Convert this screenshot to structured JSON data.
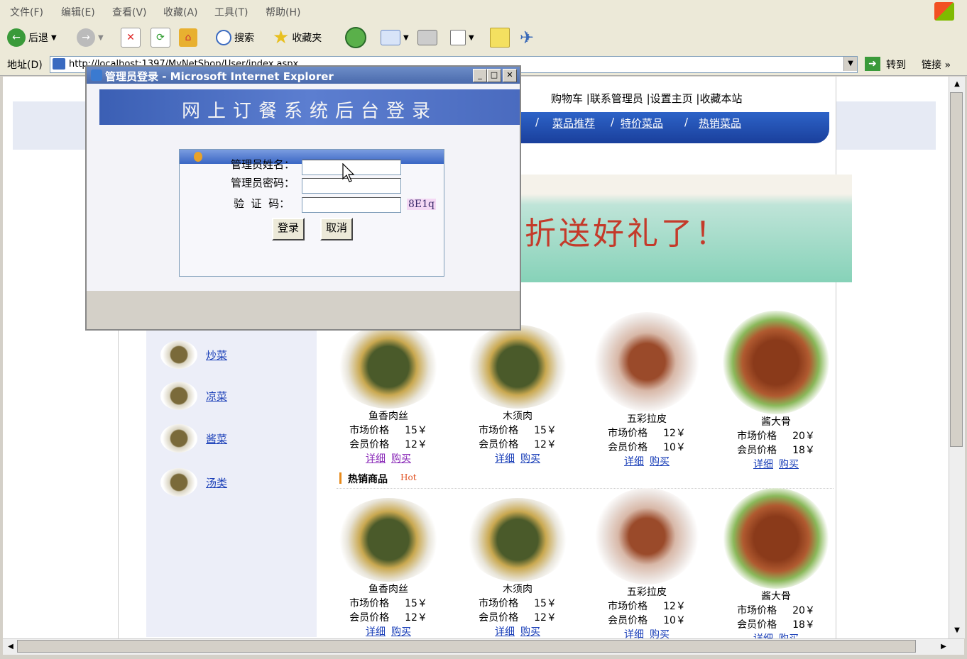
{
  "menu": [
    "文件(F)",
    "编辑(E)",
    "查看(V)",
    "收藏(A)",
    "工具(T)",
    "帮助(H)"
  ],
  "toolbar": {
    "back": "后退",
    "search": "搜索",
    "favorites": "收藏夹"
  },
  "address": {
    "label": "地址(D)",
    "url": "http://localhost:1397/MyNetShop/User/index.aspx",
    "go": "转到",
    "links": "链接 »"
  },
  "page": {
    "top_links": "购物车 |联系管理员 |设置主页 |收藏本站",
    "nav_links": [
      "菜品推荐",
      "特价菜品",
      "热销菜品"
    ],
    "nav_sep": "/",
    "banner_text": "折送好礼了！",
    "categories": [
      "炒菜",
      "凉菜",
      "酱菜",
      "汤类"
    ],
    "hot_title": "热销商品",
    "hot_tag": "Hot",
    "market_label": "市场价格",
    "member_label": "会员价格",
    "detail_link": "详细",
    "buy_link": "购买",
    "dishes": [
      {
        "name": "鱼香肉丝",
        "market": "15￥",
        "member": "12￥"
      },
      {
        "name": "木须肉",
        "market": "15￥",
        "member": "12￥"
      },
      {
        "name": "五彩拉皮",
        "market": "12￥",
        "member": "10￥"
      },
      {
        "name": "酱大骨",
        "market": "20￥",
        "member": "18￥"
      }
    ]
  },
  "dialog": {
    "title": "管理员登录 - Microsoft Internet Explorer",
    "header": "网上订餐系统后台登录",
    "username_label": "管理员姓名：",
    "password_label": "管理员密码：",
    "captcha_label": "验  证  码：",
    "captcha_value": "8E1q",
    "login_button": "登录",
    "cancel_button": "取消"
  }
}
